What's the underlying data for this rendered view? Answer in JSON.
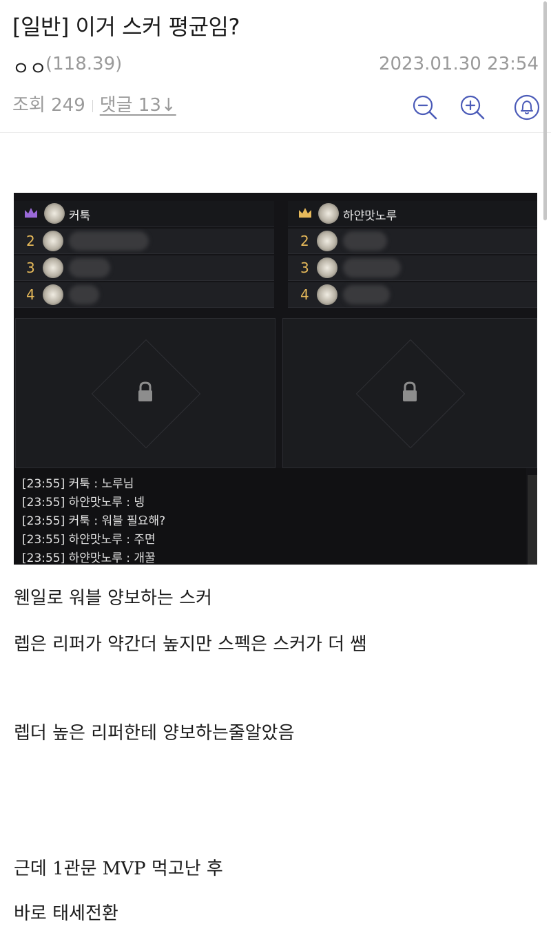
{
  "post": {
    "title": "[일반] 이거 스커 평균임?",
    "author": "ㅇㅇ",
    "author_ip": "(118.39)",
    "date": "2023.01.30 23:54",
    "views": "조회 249",
    "comments": "댓글 13↓"
  },
  "toolbar": {
    "zoom_out_icon": "zoom-out-icon",
    "zoom_in_icon": "zoom-in-icon",
    "notification_icon": "bell-icon"
  },
  "screenshot": {
    "party_left": {
      "leader": "커툭",
      "members": [
        "2",
        "3",
        "4"
      ]
    },
    "party_right": {
      "leader": "하얀맛노루",
      "members": [
        "2",
        "3",
        "4"
      ]
    },
    "chat": [
      "[23:55] 커툭 : 노루님",
      "[23:55] 하얀맛노루 : 넹",
      "[23:55] 커툭 : 워블 필요해?",
      "[23:55] 하얀맛노루 : 주면",
      "[23:55] 하얀맛노루 : 개꿀"
    ]
  },
  "body": {
    "p1": "웬일로 워블 양보하는 스커",
    "p2": "렙은 리퍼가 약간더 높지만 스펙은 스커가 더 쌤",
    "p3": "렙더 높은 리퍼한테 양보하는줄알았음",
    "p4": "근데 1관문 MVP 먹고난 후",
    "p5": "바로 태세전환"
  },
  "colors": {
    "accent": "#4b5bb8",
    "muted_text": "#9a9a9a",
    "game_bg": "#141417",
    "slot_number": "#e6b95a"
  }
}
